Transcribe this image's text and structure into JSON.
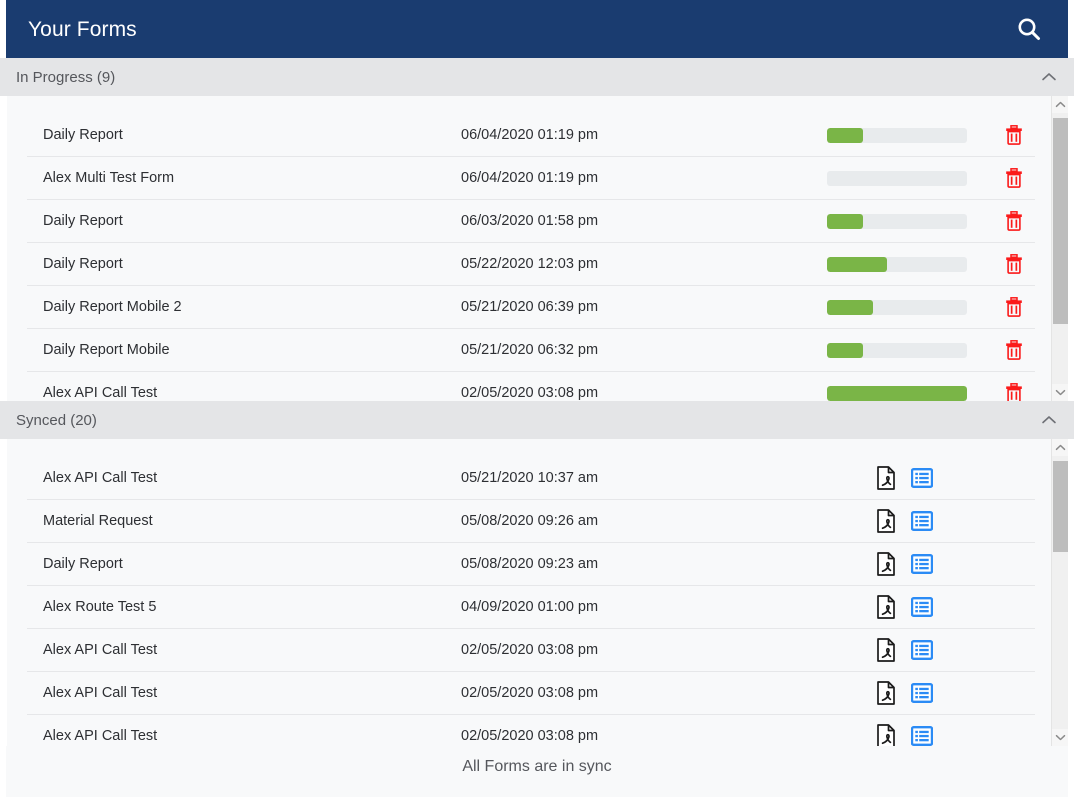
{
  "header": {
    "title": "Your Forms",
    "search_icon": "search-icon",
    "background_color": "#1a3c70",
    "text_color": "#ffffff"
  },
  "sections": [
    {
      "id": "in-progress",
      "label": "In Progress (9)",
      "count": 9,
      "collapse_icon": "chevron-up-icon",
      "row_action_icons": [
        "delete-icon"
      ],
      "accent_color": "#7ab547",
      "delete_color": "#fb1a1a",
      "scrollbar": {
        "thumb_top_pct": 2,
        "thumb_height_pct": 76
      },
      "rows": [
        {
          "name": "Daily Report",
          "date": "06/04/2020 01:19 pm",
          "progress": 26
        },
        {
          "name": "Alex Multi Test Form",
          "date": "06/04/2020 01:19 pm",
          "progress": 0
        },
        {
          "name": "Daily Report",
          "date": "06/03/2020 01:58 pm",
          "progress": 26
        },
        {
          "name": "Daily Report",
          "date": "05/22/2020 12:03 pm",
          "progress": 43
        },
        {
          "name": "Daily Report Mobile 2",
          "date": "05/21/2020 06:39 pm",
          "progress": 33
        },
        {
          "name": "Daily Report Mobile",
          "date": "05/21/2020 06:32 pm",
          "progress": 26
        },
        {
          "name": "Alex API Call Test",
          "date": "02/05/2020 03:08 pm",
          "progress": 100
        }
      ]
    },
    {
      "id": "synced",
      "label": "Synced (20)",
      "count": 20,
      "collapse_icon": "chevron-up-icon",
      "row_action_icons": [
        "pdf-icon",
        "form-view-icon"
      ],
      "form_icon_color": "#2b8bf5",
      "scrollbar": {
        "thumb_top_pct": 2,
        "thumb_height_pct": 33
      },
      "rows": [
        {
          "name": "Alex API Call Test",
          "date": "05/21/2020 10:37 am"
        },
        {
          "name": "Material Request",
          "date": "05/08/2020 09:26 am"
        },
        {
          "name": "Daily Report",
          "date": "05/08/2020 09:23 am"
        },
        {
          "name": "Alex Route Test 5",
          "date": "04/09/2020 01:00 pm"
        },
        {
          "name": "Alex API Call Test",
          "date": "02/05/2020 03:08 pm"
        },
        {
          "name": "Alex API Call Test",
          "date": "02/05/2020 03:08 pm"
        },
        {
          "name": "Alex API Call Test",
          "date": "02/05/2020 03:08 pm"
        }
      ]
    }
  ],
  "footer": {
    "status_text": "All Forms are in sync"
  }
}
